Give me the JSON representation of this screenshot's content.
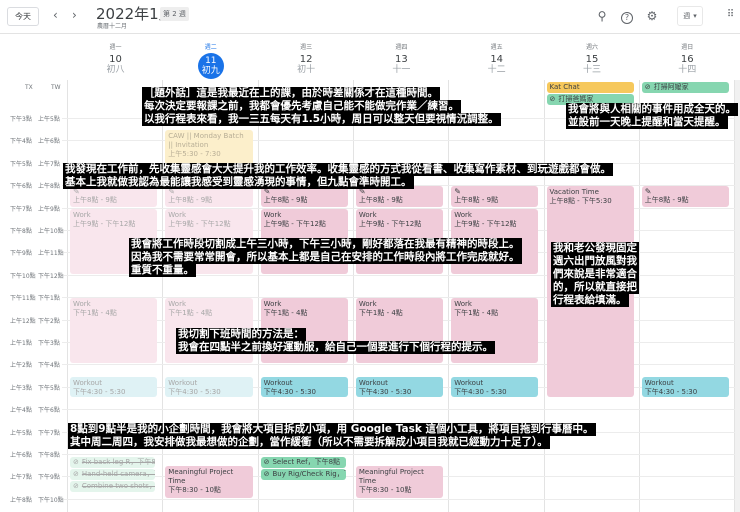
{
  "header": {
    "today_label": "今天",
    "prev_icon": "chevron-left-icon",
    "next_icon": "chevron-right-icon",
    "title": "2022年1月",
    "week_badge": "第 2 週",
    "lunar_month": "農曆十二月",
    "view_select": "週",
    "icons": [
      "search-icon",
      "help-icon",
      "gear-icon",
      "apps-grid-icon"
    ]
  },
  "timezones": [
    "TX",
    "TW"
  ],
  "days": [
    {
      "dow": "週一",
      "num": "10",
      "lunar": "初八"
    },
    {
      "dow": "週二",
      "num": "11",
      "lunar": "初九",
      "today": true
    },
    {
      "dow": "週三",
      "num": "12",
      "lunar": "初十"
    },
    {
      "dow": "週四",
      "num": "13",
      "lunar": "十一"
    },
    {
      "dow": "週五",
      "num": "14",
      "lunar": "十二"
    },
    {
      "dow": "週六",
      "num": "15",
      "lunar": "十三"
    },
    {
      "dow": "週日",
      "num": "16",
      "lunar": "十四"
    }
  ],
  "time_rows": [
    {
      "tx": "下午3點",
      "tw": "上午5點"
    },
    {
      "tx": "下午4點",
      "tw": "上午6點"
    },
    {
      "tx": "下午5點",
      "tw": "上午7點"
    },
    {
      "tx": "下午6點",
      "tw": "上午8點"
    },
    {
      "tx": "下午7點",
      "tw": "上午9點"
    },
    {
      "tx": "下午8點",
      "tw": "上午10點"
    },
    {
      "tx": "下午9點",
      "tw": "上午11點"
    },
    {
      "tx": "下午10點",
      "tw": "下午12點"
    },
    {
      "tx": "下午11點",
      "tw": "下午1點"
    },
    {
      "tx": "上午12點",
      "tw": "下午2點"
    },
    {
      "tx": "上午1點",
      "tw": "下午3點"
    },
    {
      "tx": "上午2點",
      "tw": "下午4點"
    },
    {
      "tx": "上午3點",
      "tw": "下午5點"
    },
    {
      "tx": "上午4點",
      "tw": "下午6點"
    },
    {
      "tx": "上午5點",
      "tw": "下午7點"
    },
    {
      "tx": "上午6點",
      "tw": "下午8點"
    },
    {
      "tx": "上午7點",
      "tw": "下午9點"
    },
    {
      "tx": "上午8點",
      "tw": "下午10點"
    }
  ],
  "all_day": [
    {
      "day": 5,
      "slot": 0,
      "color": "yellow",
      "title": "Kat Chat"
    },
    {
      "day": 5,
      "slot": 1,
      "color": "green",
      "task": true,
      "title": "打掃爸媽家"
    },
    {
      "day": 6,
      "slot": 0,
      "color": "green",
      "task": true,
      "title": "打掃阿嬤家"
    }
  ],
  "events": [
    {
      "day": 1,
      "start": 5.5,
      "end": 7.5,
      "color": "yellow",
      "past": true,
      "title": "CAW || Monday Batch || Invitation",
      "time": "上午5:30 - 7:30"
    },
    {
      "day": 0,
      "start": 8,
      "end": 9,
      "color": "pink",
      "past": true,
      "pencil": true,
      "title": "",
      "time": "上午8點 - 9點"
    },
    {
      "day": 1,
      "start": 8,
      "end": 9,
      "color": "pink",
      "past": true,
      "pencil": true,
      "title": "",
      "time": "上午8點 - 9點"
    },
    {
      "day": 2,
      "start": 8,
      "end": 9,
      "color": "pink",
      "pencil": true,
      "title": "",
      "time": "上午8點 - 9點"
    },
    {
      "day": 3,
      "start": 8,
      "end": 9,
      "color": "pink",
      "pencil": true,
      "title": "",
      "time": "上午8點 - 9點"
    },
    {
      "day": 4,
      "start": 8,
      "end": 9,
      "color": "pink",
      "pencil": true,
      "title": "",
      "time": "上午8點 - 9點"
    },
    {
      "day": 6,
      "start": 8,
      "end": 9,
      "color": "pink",
      "pencil": true,
      "title": "",
      "time": "上午8點 - 9點"
    },
    {
      "day": 5,
      "start": 8,
      "end": 17.5,
      "color": "pink",
      "title": "Vacation Time",
      "time": "上午8點 - 下午5:30"
    },
    {
      "day": 0,
      "start": 9,
      "end": 12,
      "color": "pink",
      "past": true,
      "title": "Work",
      "time": "上午9點 - 下午12點"
    },
    {
      "day": 1,
      "start": 9,
      "end": 12,
      "color": "pink",
      "past": true,
      "title": "Work",
      "time": "上午9點 - 下午12點"
    },
    {
      "day": 2,
      "start": 9,
      "end": 12,
      "color": "pink",
      "title": "Work",
      "time": "上午9點 - 下午12點"
    },
    {
      "day": 3,
      "start": 9,
      "end": 12,
      "color": "pink",
      "title": "Work",
      "time": "上午9點 - 下午12點"
    },
    {
      "day": 4,
      "start": 9,
      "end": 12,
      "color": "pink",
      "title": "Work",
      "time": "上午9點 - 下午12點"
    },
    {
      "day": 0,
      "start": 13,
      "end": 16,
      "color": "pink",
      "past": true,
      "title": "Work",
      "time": "下午1點 - 4點"
    },
    {
      "day": 1,
      "start": 13,
      "end": 16,
      "color": "pink",
      "past": true,
      "title": "Work",
      "time": "下午1點 - 4點"
    },
    {
      "day": 2,
      "start": 13,
      "end": 16,
      "color": "pink",
      "title": "Work",
      "time": "下午1點 - 4點"
    },
    {
      "day": 3,
      "start": 13,
      "end": 16,
      "color": "pink",
      "title": "Work",
      "time": "下午1點 - 4點"
    },
    {
      "day": 4,
      "start": 13,
      "end": 16,
      "color": "pink",
      "title": "Work",
      "time": "下午1點 - 4點"
    },
    {
      "day": 0,
      "start": 16.5,
      "end": 17.5,
      "color": "teal",
      "past": true,
      "title": "Workout",
      "time": "下午4:30 - 5:30"
    },
    {
      "day": 1,
      "start": 16.5,
      "end": 17.5,
      "color": "teal",
      "past": true,
      "title": "Workout",
      "time": "下午4:30 - 5:30"
    },
    {
      "day": 2,
      "start": 16.5,
      "end": 17.5,
      "color": "teal",
      "title": "Workout",
      "time": "下午4:30 - 5:30"
    },
    {
      "day": 3,
      "start": 16.5,
      "end": 17.5,
      "color": "teal",
      "title": "Workout",
      "time": "下午4:30 - 5:30"
    },
    {
      "day": 4,
      "start": 16.5,
      "end": 17.5,
      "color": "teal",
      "title": "Workout",
      "time": "下午4:30 - 5:30"
    },
    {
      "day": 6,
      "start": 16.5,
      "end": 17.5,
      "color": "teal",
      "title": "Workout",
      "time": "下午4:30 - 5:30"
    },
    {
      "day": 1,
      "start": 20.5,
      "end": 22,
      "color": "pink",
      "title": "Meaningful Project Time",
      "time": "下午8:30 - 10點"
    },
    {
      "day": 3,
      "start": 20.5,
      "end": 22,
      "color": "pink",
      "title": "Meaningful Project Time",
      "time": "下午8:30 - 10點"
    }
  ],
  "tasks": [
    {
      "day": 0,
      "slot": 0,
      "past": true,
      "title": "Fix back leg R，下午8點"
    },
    {
      "day": 0,
      "slot": 1,
      "past": true,
      "title": "Hand-held camera，下午"
    },
    {
      "day": 0,
      "slot": 2,
      "past": true,
      "title": "Combine two shots，下"
    },
    {
      "day": 2,
      "slot": 0,
      "title": "Select Ref，下午8點"
    },
    {
      "day": 2,
      "slot": 1,
      "title": "Buy Rig/Check Rig，下午"
    }
  ],
  "annotations": {
    "aside": [
      "［題外話］這是我最近在上的課，由於時差關係才在這種時間。",
      "每次決定要報課之前，我都會優先考慮自己能不能做完作業／練習。",
      "以我行程表來看，我一三五每天有1.5小時，周日可以整天但要視情況調整。"
    ],
    "people": [
      "我會將與人相關的事件用成全天的。",
      "並設前一天晚上提醒和當天提醒。"
    ],
    "inspiration": [
      "我發現在工作前，先收集靈感會大大提升我的工作效率。收集靈感的方式我從看書、收集寫作素材、到玩遊戲都會做。",
      "基本上我就做我認為最能讓我感受到靈感湧現的事情，但九點會準時開工。"
    ],
    "work_blocks": [
      "我會將工作時段切割成上午三小時，下午三小時，剛好都落在我最有精神的時段上。",
      "因為我不需要常常開會，所以基本上都是自己在安排的工作時段內將工作完成就好。",
      "重質不重量。"
    ],
    "saturday": [
      "我和老公發現固定",
      "週六出門放風對我",
      "們來說是非常適合",
      "的，所以就直接把",
      "行程表給填滿。"
    ],
    "off_work": [
      "我切割下班時間的方法是：",
      "我會在四點半之前換好運動服，給自己一個要進行下個行程的提示。"
    ],
    "planning": [
      "8點到9點半是我的小企劃時間，我會將大項目拆成小項，用 Google Task 這個小工具，將項目拖到行事曆中。",
      "其中周二周四，我安排做我最想做的企劃，當作緩衝（所以不需要拆解成小項目我就已經動力十足了）。"
    ]
  }
}
